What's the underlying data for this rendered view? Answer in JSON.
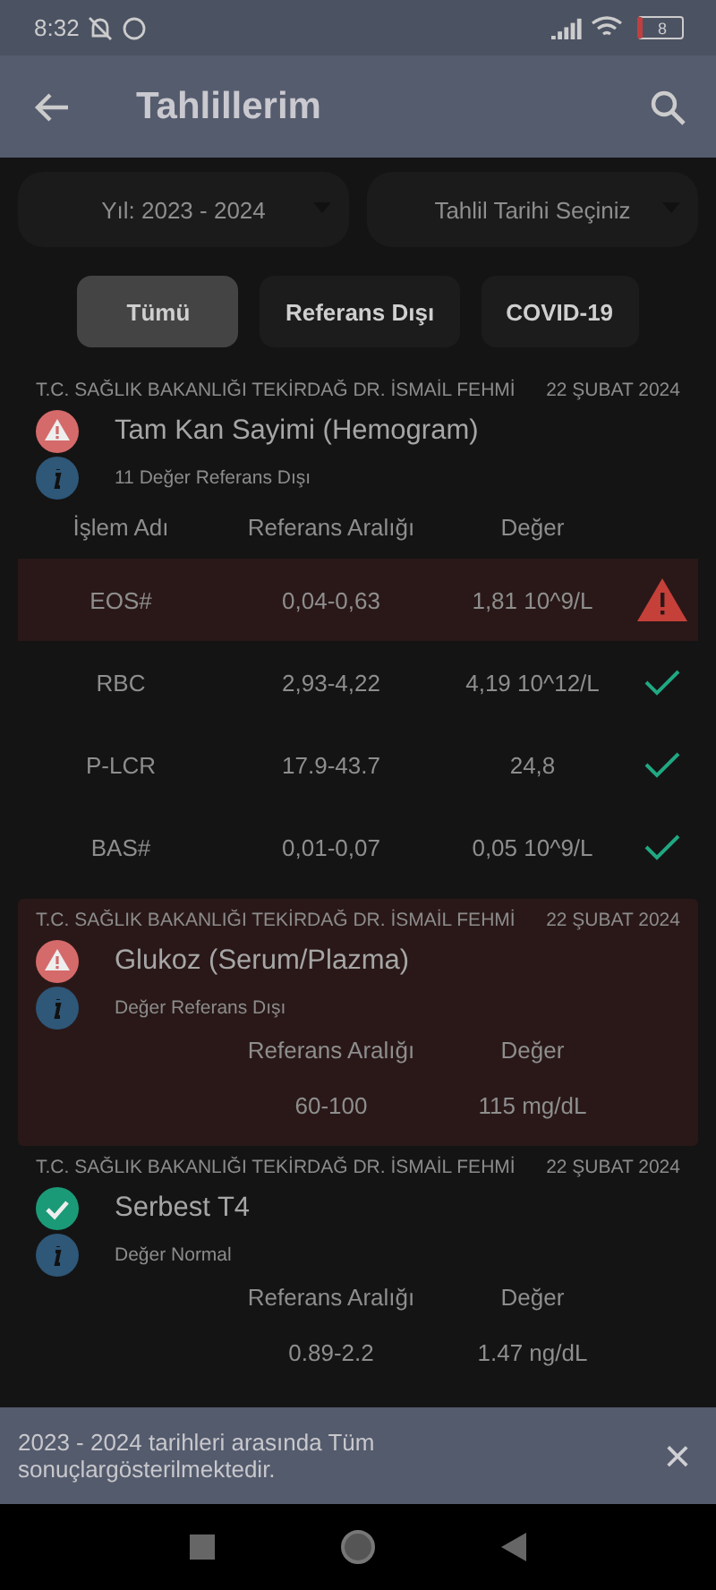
{
  "status_bar": {
    "time": "8:32",
    "battery": "8"
  },
  "app_bar": {
    "title": "Tahlillerim"
  },
  "filters": [
    {
      "label": "Yıl: 2023 - 2024"
    },
    {
      "label": "Tahlil Tarihi Seçiniz"
    }
  ],
  "chips": [
    {
      "label": "Tümü",
      "selected": true
    },
    {
      "label": "Referans Dışı",
      "selected": false
    },
    {
      "label": "COVID-19",
      "selected": false
    }
  ],
  "results": [
    {
      "hospital": "T.C. SAĞLIK BAKANLIĞI TEKİRDAĞ DR. İSMAİL FEHMİ",
      "date": "22 ŞUBAT 2024",
      "name": "Tam Kan Sayimi (Hemogram)",
      "out_of_range": true,
      "summary": "11 Değer Referans Dışı",
      "highlighted": false,
      "columns": [
        "İşlem Adı",
        "Referans Aralığı",
        "Değer"
      ],
      "rows": [
        {
          "cells": [
            "EOS#",
            "0,04-0,63",
            "1,81 10^9/L"
          ],
          "out_of_range": true
        },
        {
          "cells": [
            "RBC",
            "2,93-4,22",
            "4,19 10^12/L"
          ],
          "out_of_range": false
        },
        {
          "cells": [
            "P-LCR",
            "17.9-43.7",
            "24,8"
          ],
          "out_of_range": false
        },
        {
          "cells": [
            "BAS#",
            "0,01-0,07",
            "0,05 10^9/L"
          ],
          "out_of_range": false
        }
      ]
    },
    {
      "hospital": "T.C. SAĞLIK BAKANLIĞI TEKİRDAĞ DR. İSMAİL FEHMİ",
      "date": "22 ŞUBAT 2024",
      "name": "Glukoz (Serum/Plazma)",
      "out_of_range": true,
      "summary": "Değer Referans Dışı",
      "highlighted": true,
      "columns": [
        "Referans Aralığı",
        "Değer"
      ],
      "rows": [
        {
          "cells": [
            "60-100",
            "115 mg/dL"
          ]
        }
      ]
    },
    {
      "hospital": "T.C. SAĞLIK BAKANLIĞI TEKİRDAĞ DR. İSMAİL FEHMİ",
      "date": "22 ŞUBAT 2024",
      "name": "Serbest T4",
      "out_of_range": false,
      "summary": "Değer Normal",
      "highlighted": false,
      "columns": [
        "Referans Aralığı",
        "Değer"
      ],
      "rows": [
        {
          "cells": [
            "0.89-2.2",
            "1.47 ng/dL"
          ]
        }
      ]
    }
  ],
  "snackbar": {
    "message": "2023 - 2024 tarihleri arasında Tüm sonuçlargösterilmektedir.",
    "close": "×"
  }
}
